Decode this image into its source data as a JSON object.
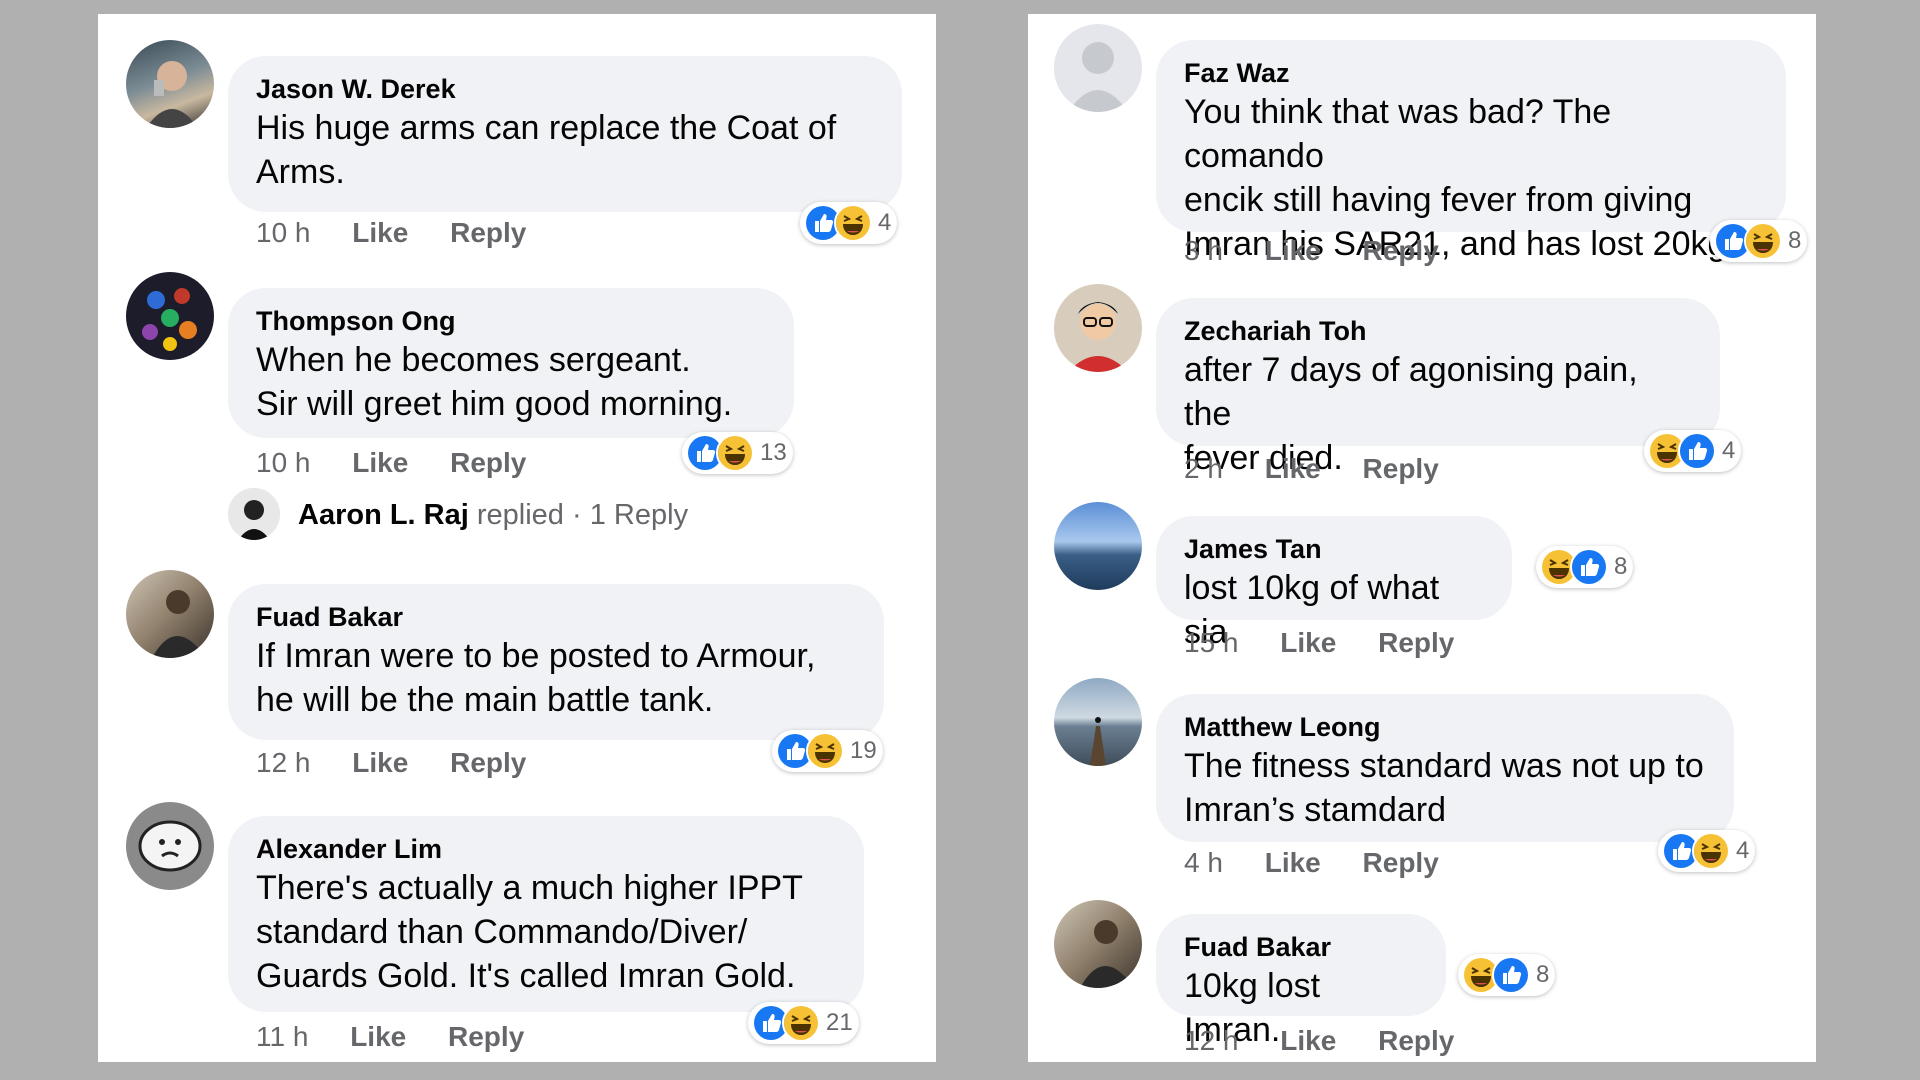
{
  "left_column": [
    {
      "author": "Jason W. Derek",
      "text": "His huge arms can replace the Coat of\nArms.",
      "time": "10 h",
      "like": "Like",
      "reply": "Reply",
      "reactions": [
        "like",
        "haha"
      ],
      "count": "4"
    },
    {
      "author": "Thompson Ong",
      "text": "When he becomes sergeant.\nSir will greet him good morning.",
      "time": "10 h",
      "like": "Like",
      "reply": "Reply",
      "reactions": [
        "like",
        "haha"
      ],
      "count": "13",
      "replied": {
        "name": "Aaron L. Raj",
        "verb": "replied",
        "sep": "·",
        "count_label": "1 Reply"
      }
    },
    {
      "author": "Fuad Bakar",
      "text": "If Imran were to be posted to Armour,\nhe will be the main battle tank.",
      "time": "12 h",
      "like": "Like",
      "reply": "Reply",
      "reactions": [
        "like",
        "haha"
      ],
      "count": "19"
    },
    {
      "author": "Alexander Lim",
      "text": "There's actually a much higher IPPT\nstandard than Commando/Diver/\nGuards Gold. It's called Imran Gold.",
      "time": "11 h",
      "like": "Like",
      "reply": "Reply",
      "reactions": [
        "like",
        "haha"
      ],
      "count": "21"
    }
  ],
  "right_column": [
    {
      "author": "Faz Waz",
      "text": "You think that was bad? The comando\nencik still having fever from giving\nImran his SAR21, and has lost 20kg",
      "time": "3 h",
      "like": "Like",
      "reply": "Reply",
      "reactions": [
        "like",
        "haha"
      ],
      "count": "8"
    },
    {
      "author": "Zechariah Toh",
      "text": "after 7 days of agonising pain, the\nfever died.",
      "time": "2 h",
      "like": "Like",
      "reply": "Reply",
      "reactions": [
        "haha",
        "like"
      ],
      "count": "4"
    },
    {
      "author": "James Tan",
      "text": "lost 10kg of what sia",
      "time": "15 h",
      "like": "Like",
      "reply": "Reply",
      "reactions": [
        "haha",
        "like"
      ],
      "count": "8"
    },
    {
      "author": "Matthew Leong",
      "text": "The fitness standard was not up to\nImran’s stamdard",
      "time": "4 h",
      "like": "Like",
      "reply": "Reply",
      "reactions": [
        "like",
        "haha"
      ],
      "count": "4"
    },
    {
      "author": "Fuad Bakar",
      "text": "10kg lost Imran.",
      "time": "12 h",
      "like": "Like",
      "reply": "Reply",
      "reactions": [
        "haha",
        "like"
      ],
      "count": "8"
    }
  ],
  "colors": {
    "bubble": "#f0f2f5",
    "like_blue": "#1877f2",
    "haha_yellow": "#f7c136",
    "meta_gray": "#65676b",
    "text": "#050505"
  }
}
